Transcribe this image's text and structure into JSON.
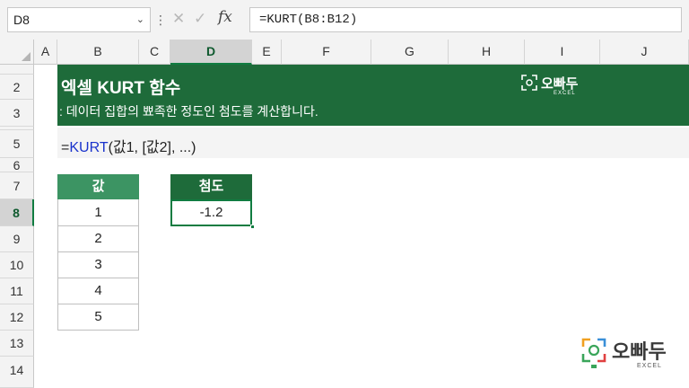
{
  "formula_bar": {
    "name_box": "D8",
    "formula": "=KURT(B8:B12)"
  },
  "columns": [
    "A",
    "B",
    "C",
    "D",
    "E",
    "F",
    "G",
    "H",
    "I",
    "J"
  ],
  "rows": [
    "",
    "2",
    "3",
    "",
    "5",
    "6",
    "7",
    "8",
    "9",
    "10",
    "11",
    "12",
    "13",
    "14"
  ],
  "selection": {
    "column": "D",
    "row": "8"
  },
  "banner": {
    "title": "엑셀 KURT 함수",
    "subtitle": ": 데이터 집합의 뾰족한 정도인 첨도를 계산합니다.",
    "logo_name": "오빠두",
    "logo_sub": "EXCEL"
  },
  "syntax": {
    "prefix": "=",
    "function": "KURT",
    "args": "(값1, [값2], ...)"
  },
  "values_table": {
    "header": "값",
    "values": [
      "1",
      "2",
      "3",
      "4",
      "5"
    ]
  },
  "result_table": {
    "header": "첨도",
    "value": "-1.2"
  },
  "corner_logo": {
    "name": "오빠두",
    "sub": "EXCEL"
  },
  "colors": {
    "banner": "#1e6b3a",
    "table_header": "#3c9463",
    "selection": "#107c41",
    "function_name": "#1a33cc"
  }
}
